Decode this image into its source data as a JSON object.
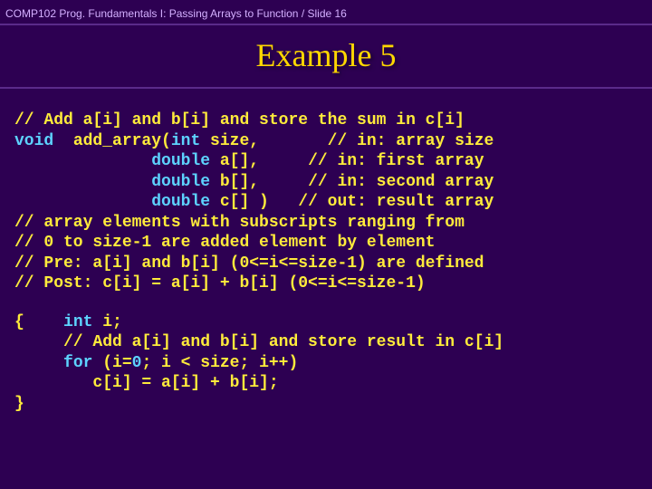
{
  "header": "COMP102  Prog. Fundamentals I: Passing Arrays to Function / Slide 16",
  "title": "Example 5",
  "code": {
    "l1": "// Add a[i] and b[i] and store the sum in c[i]",
    "l2a": "void",
    "l2b": "  add_array(",
    "l2c": "int",
    "l2d": " size,       // in: array size",
    "l3a": "              ",
    "l3b": "double",
    "l3c": " a[],     // in: first array",
    "l4a": "              ",
    "l4b": "double",
    "l4c": " b[],     // in: second array",
    "l5a": "              ",
    "l5b": "double",
    "l5c": " c[] )   // out: result array",
    "l6": "// array elements with subscripts ranging from",
    "l7": "// 0 to size-1 are added element by element",
    "l8": "// Pre: a[i] and b[i] (0<=i<=size-1) are defined",
    "l9": "// Post: c[i] = a[i] + b[i] (0<=i<=size-1)",
    "l11a": "{    ",
    "l11b": "int",
    "l11c": " i;",
    "l12": "     // Add a[i] and b[i] and store result in c[i]",
    "l13a": "     ",
    "l13b": "for",
    "l13c": " (i=",
    "l13d": "0",
    "l13e": "; i < size; i++)",
    "l14": "        c[i] = a[i] + b[i];",
    "l15": "}"
  }
}
